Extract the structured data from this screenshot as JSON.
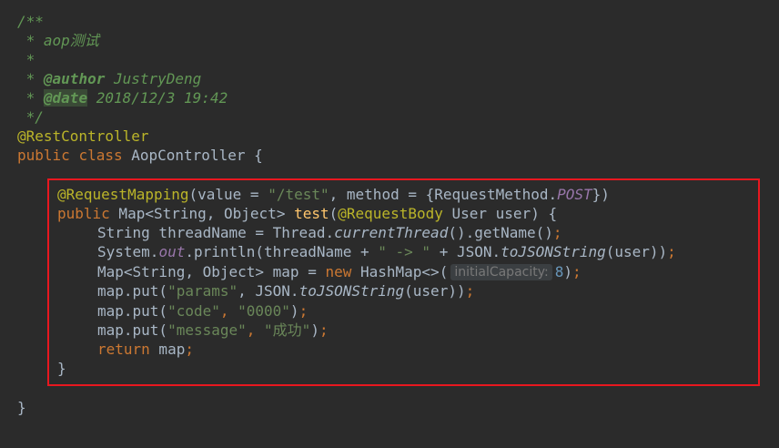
{
  "code": {
    "doc_open": "/**",
    "doc_desc": " * aop测试",
    "doc_empty": " *",
    "doc_author_prefix": " * ",
    "doc_author_tag": "@author",
    "doc_author_value": " JustryDeng",
    "doc_date_prefix": " * ",
    "doc_date_tag": "@date",
    "doc_date_value": " 2018/12/3 19:42",
    "doc_close": " */",
    "class_annotation": "@RestController",
    "class_kw1": "public",
    "class_kw2": "class",
    "class_name": " AopController {",
    "mapping_annotation": "@RequestMapping",
    "mapping_args_1": "(value = ",
    "mapping_path": "\"/test\"",
    "mapping_args_2": ", method = {RequestMethod.",
    "mapping_method": "POST",
    "mapping_args_3": "})",
    "method_kw": "public",
    "method_return": " Map<String, Object> ",
    "method_name": "test",
    "method_paren": "(",
    "method_param_ann": "@RequestBody",
    "method_params": " User user) {",
    "l1_a": "String threadName = Thread.",
    "l1_b": "currentThread",
    "l1_c": "().getName()",
    "l1_semi": ";",
    "l2_a": "System.",
    "l2_out": "out",
    "l2_b": ".println(threadName + ",
    "l2_str": "\" -> \"",
    "l2_c": " + JSON.",
    "l2_fn": "toJSONString",
    "l2_d": "(user))",
    "l2_semi": ";",
    "l3_a": "Map<String, Object> map = ",
    "l3_new": "new",
    "l3_b": " HashMap<>(",
    "l3_hint": "initialCapacity:",
    "l3_num": "8",
    "l3_c": ")",
    "l3_semi": ";",
    "l4_a": "map.put(",
    "l4_str": "\"params\"",
    "l4_b": ", JSON.",
    "l4_fn": "toJSONString",
    "l4_c": "(user))",
    "l4_semi": ";",
    "l5_a": "map.put(",
    "l5_str1": "\"code\"",
    "l5_comma": ", ",
    "l5_str2": "\"0000\"",
    "l5_b": ")",
    "l5_semi": ";",
    "l6_a": "map.put(",
    "l6_str1": "\"message\"",
    "l6_comma": ", ",
    "l6_str2": "\"成功\"",
    "l6_b": ")",
    "l6_semi": ";",
    "l7_kw": "return",
    "l7_a": " map",
    "l7_semi": ";",
    "method_close": "}",
    "class_close": "}"
  },
  "colors": {
    "background": "#2b2b2b",
    "default_text": "#a9b7c6",
    "keyword": "#cc7832",
    "string": "#6a8759",
    "annotation": "#bbb529",
    "doc_comment": "#629755",
    "static_field": "#9876aa",
    "number": "#6897bb",
    "method_decl": "#ffc66d",
    "highlight_border": "#e8171f"
  }
}
